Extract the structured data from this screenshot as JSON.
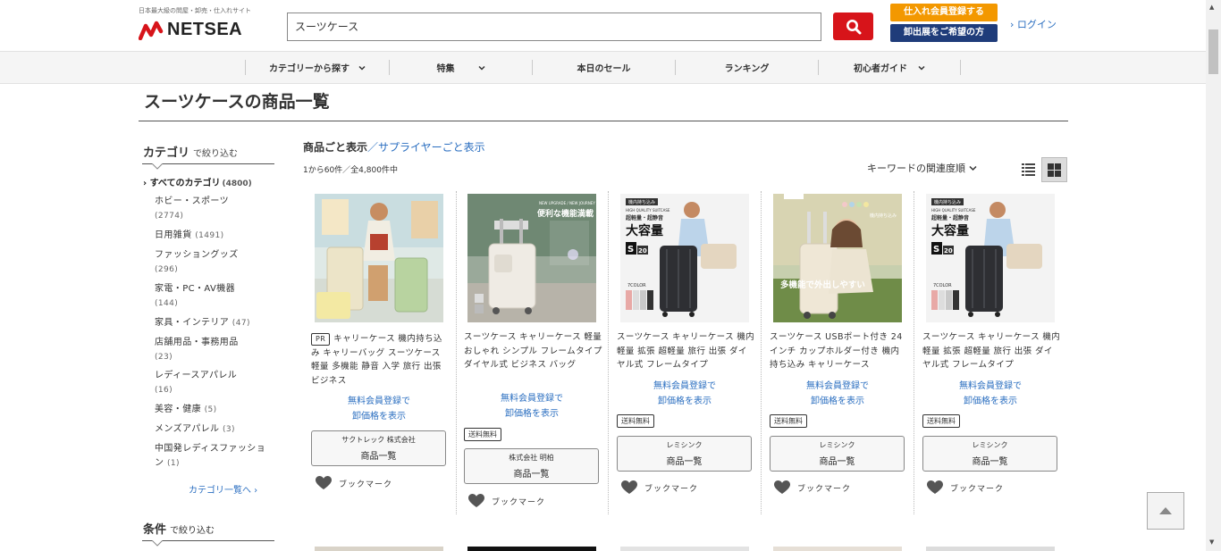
{
  "header": {
    "tagline": "日本最大級の問屋・卸売・仕入れサイト",
    "logo_text": "NETSEA",
    "search_value": "スーツケース",
    "register_button": "仕入れ会員登録する",
    "exhibit_button": "卸出展をご希望の方",
    "login_link": "› ログイン"
  },
  "nav": {
    "items": [
      {
        "label": "カテゴリーから探す"
      },
      {
        "label": "特集"
      },
      {
        "label": "本日のセール"
      },
      {
        "label": "ランキング"
      },
      {
        "label": "初心者ガイド"
      }
    ]
  },
  "page_title": "スーツケースの商品一覧",
  "sidebar": {
    "category_heading": "カテゴリ",
    "category_heading_sub": "で絞り込む",
    "all_label": "› すべてのカテゴリ",
    "all_count": "(4800)",
    "categories": [
      {
        "label": "ホビー・スポーツ",
        "count": "(2774)"
      },
      {
        "label": "日用雑貨",
        "count": "(1491)"
      },
      {
        "label": "ファッショングッズ",
        "count": "(296)"
      },
      {
        "label": "家電・PC・AV機器",
        "count": "(144)"
      },
      {
        "label": "家具・インテリア",
        "count": "(47)"
      },
      {
        "label": "店舗用品・事務用品",
        "count": "(23)"
      },
      {
        "label": "レディースアパレル",
        "count": "(16)"
      },
      {
        "label": "美容・健康",
        "count": "(5)"
      },
      {
        "label": "メンズアパレル",
        "count": "(3)"
      },
      {
        "label": "中国発レディスファッション",
        "count": "(1)"
      }
    ],
    "more_link": "カテゴリ一覧へ ›",
    "condition_heading": "条件",
    "condition_heading_sub": "で絞り込む"
  },
  "results": {
    "view_current": "商品ごと表示",
    "view_alt": "／サプライヤーごと表示",
    "count_text": "1から60件／全4,800件中",
    "sort_label": "キーワードの関連度順"
  },
  "products": [
    {
      "pr": "PR",
      "name": "キャリーケース 機内持ち込み キャリーバッグ スーツケース 軽量 多機能 静音 入学 旅行 出張 ビジネス",
      "price_line1": "無料会員登録で",
      "price_line2": "卸価格を表示",
      "free_shipping": "",
      "supplier": "サクトレック 株式会社",
      "supplier_link": "商品一覧",
      "bookmark": "ブックマーク"
    },
    {
      "pr": "",
      "name": "スーツケース キャリーケース 軽量 おしゃれ シンプル フレームタイプ ダイヤル式 ビジネス バッグ",
      "price_line1": "無料会員登録で",
      "price_line2": "卸価格を表示",
      "free_shipping": "送料無料",
      "supplier": "株式会社 明柏",
      "supplier_link": "商品一覧",
      "bookmark": "ブックマーク",
      "img_text1": "便利な機能満載",
      "img_text2": "NEW UPGRADE / NEW JOURNEY"
    },
    {
      "pr": "",
      "name": "スーツケース キャリーケース 機内 軽量 拡張 超軽量 旅行 出張 ダイヤル式 フレームタイプ",
      "price_line1": "無料会員登録で",
      "price_line2": "卸価格を表示",
      "free_shipping": "送料無料",
      "supplier": "レミシンク",
      "supplier_link": "商品一覧",
      "bookmark": "ブックマーク",
      "img_text1": "大容量",
      "img_text2": "HIGH QUALITY SUITCASE",
      "img_text3": "超軽量・超静音",
      "img_text4": "機内持ち込み",
      "img_size": "S",
      "img_size_num": "20",
      "img_color": "7COLOR"
    },
    {
      "pr": "",
      "name": "スーツケース USBポート付き 24インチ カップホルダー付き 機内持ち込み キャリーケース",
      "price_line1": "無料会員登録で",
      "price_line2": "卸価格を表示",
      "free_shipping": "送料無料",
      "supplier": "レミシンク",
      "supplier_link": "商品一覧",
      "bookmark": "ブックマーク",
      "img_text1": "多機能で外出しやすい",
      "img_text2": "機内持ち込み"
    },
    {
      "pr": "",
      "name": "スーツケース キャリーケース 機内 軽量 拡張 超軽量 旅行 出張 ダイヤル式 フレームタイプ",
      "price_line1": "無料会員登録で",
      "price_line2": "卸価格を表示",
      "free_shipping": "送料無料",
      "supplier": "レミシンク",
      "supplier_link": "商品一覧",
      "bookmark": "ブックマーク",
      "img_text1": "大容量",
      "img_text2": "HIGH QUALITY SUITCASE",
      "img_text3": "超軽量・超静音",
      "img_text4": "機内持ち込み",
      "img_size": "S",
      "img_size_num": "20",
      "img_color": "7COLOR"
    }
  ],
  "colors": {
    "brand_red": "#d7141a",
    "register_orange": "#f39800",
    "exhibit_navy": "#1f3c7a",
    "link_blue": "#2a6ec0"
  }
}
